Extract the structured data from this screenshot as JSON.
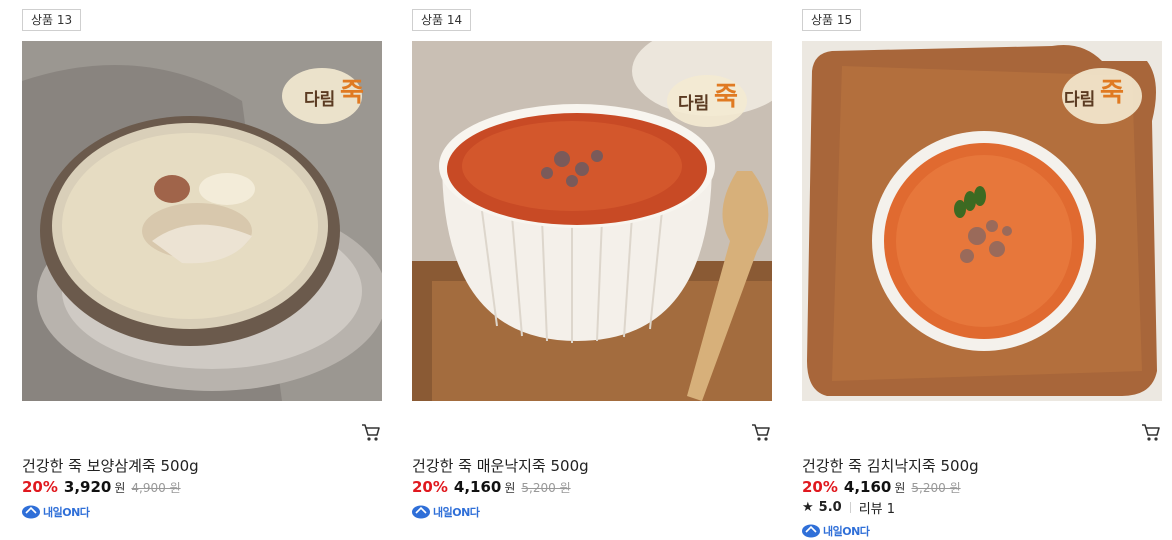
{
  "products": [
    {
      "badge": "상품 13",
      "name": "건강한 죽 보양삼계죽 500g",
      "discount": "20%",
      "price": "3,920",
      "currency": "원",
      "original_price": "4,900 원",
      "delivery": "내일ON다",
      "brand_logo": "다림죽",
      "cart_icon": "cart-icon"
    },
    {
      "badge": "상품 14",
      "name": "건강한 죽 매운낙지죽 500g",
      "discount": "20%",
      "price": "4,160",
      "currency": "원",
      "original_price": "5,200 원",
      "delivery": "내일ON다",
      "brand_logo": "다림죽",
      "cart_icon": "cart-icon"
    },
    {
      "badge": "상품 15",
      "name": "건강한 죽 김치낙지죽 500g",
      "discount": "20%",
      "price": "4,160",
      "currency": "원",
      "original_price": "5,200 원",
      "rating": "5.0",
      "review_label": "리뷰 1",
      "delivery": "내일ON다",
      "brand_logo": "다림죽",
      "cart_icon": "cart-icon"
    }
  ],
  "colors": {
    "discount": "#e0191f",
    "delivery": "#2f6fd8",
    "strike": "#999999"
  }
}
